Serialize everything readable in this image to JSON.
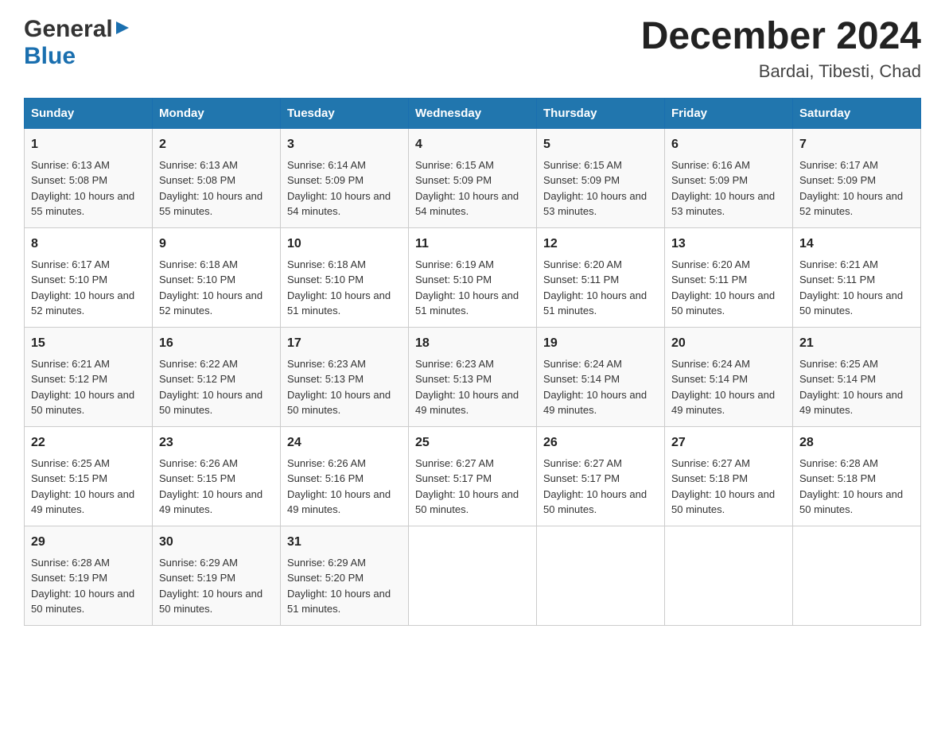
{
  "header": {
    "logo_line1": "General",
    "logo_arrow": "▶",
    "logo_line2": "Blue",
    "title": "December 2024",
    "subtitle": "Bardai, Tibesti, Chad"
  },
  "days_of_week": [
    "Sunday",
    "Monday",
    "Tuesday",
    "Wednesday",
    "Thursday",
    "Friday",
    "Saturday"
  ],
  "weeks": [
    [
      {
        "day": "1",
        "sunrise": "6:13 AM",
        "sunset": "5:08 PM",
        "daylight": "10 hours and 55 minutes."
      },
      {
        "day": "2",
        "sunrise": "6:13 AM",
        "sunset": "5:08 PM",
        "daylight": "10 hours and 55 minutes."
      },
      {
        "day": "3",
        "sunrise": "6:14 AM",
        "sunset": "5:09 PM",
        "daylight": "10 hours and 54 minutes."
      },
      {
        "day": "4",
        "sunrise": "6:15 AM",
        "sunset": "5:09 PM",
        "daylight": "10 hours and 54 minutes."
      },
      {
        "day": "5",
        "sunrise": "6:15 AM",
        "sunset": "5:09 PM",
        "daylight": "10 hours and 53 minutes."
      },
      {
        "day": "6",
        "sunrise": "6:16 AM",
        "sunset": "5:09 PM",
        "daylight": "10 hours and 53 minutes."
      },
      {
        "day": "7",
        "sunrise": "6:17 AM",
        "sunset": "5:09 PM",
        "daylight": "10 hours and 52 minutes."
      }
    ],
    [
      {
        "day": "8",
        "sunrise": "6:17 AM",
        "sunset": "5:10 PM",
        "daylight": "10 hours and 52 minutes."
      },
      {
        "day": "9",
        "sunrise": "6:18 AM",
        "sunset": "5:10 PM",
        "daylight": "10 hours and 52 minutes."
      },
      {
        "day": "10",
        "sunrise": "6:18 AM",
        "sunset": "5:10 PM",
        "daylight": "10 hours and 51 minutes."
      },
      {
        "day": "11",
        "sunrise": "6:19 AM",
        "sunset": "5:10 PM",
        "daylight": "10 hours and 51 minutes."
      },
      {
        "day": "12",
        "sunrise": "6:20 AM",
        "sunset": "5:11 PM",
        "daylight": "10 hours and 51 minutes."
      },
      {
        "day": "13",
        "sunrise": "6:20 AM",
        "sunset": "5:11 PM",
        "daylight": "10 hours and 50 minutes."
      },
      {
        "day": "14",
        "sunrise": "6:21 AM",
        "sunset": "5:11 PM",
        "daylight": "10 hours and 50 minutes."
      }
    ],
    [
      {
        "day": "15",
        "sunrise": "6:21 AM",
        "sunset": "5:12 PM",
        "daylight": "10 hours and 50 minutes."
      },
      {
        "day": "16",
        "sunrise": "6:22 AM",
        "sunset": "5:12 PM",
        "daylight": "10 hours and 50 minutes."
      },
      {
        "day": "17",
        "sunrise": "6:23 AM",
        "sunset": "5:13 PM",
        "daylight": "10 hours and 50 minutes."
      },
      {
        "day": "18",
        "sunrise": "6:23 AM",
        "sunset": "5:13 PM",
        "daylight": "10 hours and 49 minutes."
      },
      {
        "day": "19",
        "sunrise": "6:24 AM",
        "sunset": "5:14 PM",
        "daylight": "10 hours and 49 minutes."
      },
      {
        "day": "20",
        "sunrise": "6:24 AM",
        "sunset": "5:14 PM",
        "daylight": "10 hours and 49 minutes."
      },
      {
        "day": "21",
        "sunrise": "6:25 AM",
        "sunset": "5:14 PM",
        "daylight": "10 hours and 49 minutes."
      }
    ],
    [
      {
        "day": "22",
        "sunrise": "6:25 AM",
        "sunset": "5:15 PM",
        "daylight": "10 hours and 49 minutes."
      },
      {
        "day": "23",
        "sunrise": "6:26 AM",
        "sunset": "5:15 PM",
        "daylight": "10 hours and 49 minutes."
      },
      {
        "day": "24",
        "sunrise": "6:26 AM",
        "sunset": "5:16 PM",
        "daylight": "10 hours and 49 minutes."
      },
      {
        "day": "25",
        "sunrise": "6:27 AM",
        "sunset": "5:17 PM",
        "daylight": "10 hours and 50 minutes."
      },
      {
        "day": "26",
        "sunrise": "6:27 AM",
        "sunset": "5:17 PM",
        "daylight": "10 hours and 50 minutes."
      },
      {
        "day": "27",
        "sunrise": "6:27 AM",
        "sunset": "5:18 PM",
        "daylight": "10 hours and 50 minutes."
      },
      {
        "day": "28",
        "sunrise": "6:28 AM",
        "sunset": "5:18 PM",
        "daylight": "10 hours and 50 minutes."
      }
    ],
    [
      {
        "day": "29",
        "sunrise": "6:28 AM",
        "sunset": "5:19 PM",
        "daylight": "10 hours and 50 minutes."
      },
      {
        "day": "30",
        "sunrise": "6:29 AM",
        "sunset": "5:19 PM",
        "daylight": "10 hours and 50 minutes."
      },
      {
        "day": "31",
        "sunrise": "6:29 AM",
        "sunset": "5:20 PM",
        "daylight": "10 hours and 51 minutes."
      },
      null,
      null,
      null,
      null
    ]
  ],
  "labels": {
    "sunrise": "Sunrise:",
    "sunset": "Sunset:",
    "daylight": "Daylight:"
  }
}
